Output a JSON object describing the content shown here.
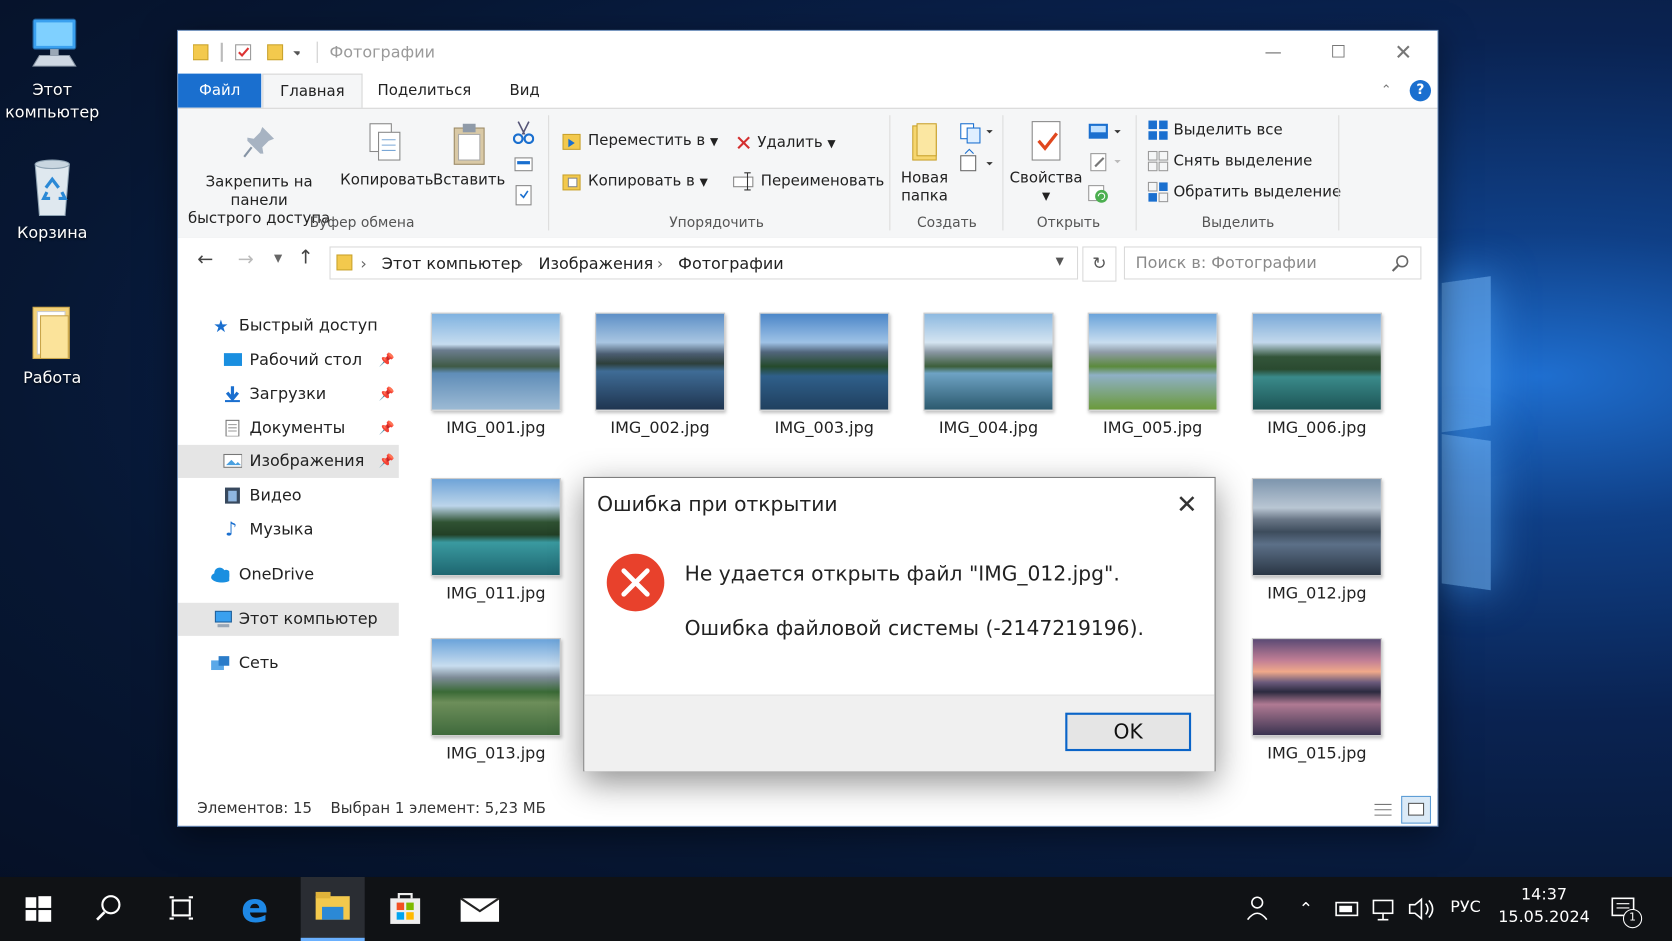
{
  "desktop": {
    "icons": [
      {
        "label_line1": "Этот",
        "label_line2": "компьютер"
      },
      {
        "label_line1": "Корзина",
        "label_line2": ""
      },
      {
        "label_line1": "Работа",
        "label_line2": ""
      }
    ]
  },
  "window": {
    "title": "Фотографии",
    "tabs": [
      "Файл",
      "Главная",
      "Поделиться",
      "Вид"
    ],
    "ribbon": {
      "pin": [
        "Закрепить на панели",
        "быстрого доступа"
      ],
      "copy": "Копировать",
      "paste": "Вставить",
      "group_clipboard": "Буфер обмена",
      "move_to": "Переместить в",
      "copy_to": "Копировать в",
      "delete": "Удалить",
      "rename": "Переименовать",
      "group_organize": "Упорядочить",
      "new_folder": [
        "Новая",
        "папка"
      ],
      "group_create": "Создать",
      "properties": "Свойства",
      "group_open": "Открыть",
      "select_all": "Выделить все",
      "select_none": "Снять выделение",
      "invert_selection": "Обратить выделение",
      "group_select": "Выделить"
    },
    "address": {
      "crumbs": [
        "Этот компьютер",
        "Изображения",
        "Фотографии"
      ],
      "search_placeholder": "Поиск в: Фотографии"
    },
    "nav": {
      "quick_access": "Быстрый доступ",
      "desktop": "Рабочий стол",
      "downloads": "Загрузки",
      "documents": "Документы",
      "pictures": "Изображения",
      "videos": "Видео",
      "music": "Музыка",
      "onedrive": "OneDrive",
      "this_pc": "Этот компьютер",
      "network": "Сеть"
    },
    "files": [
      "IMG_001.jpg",
      "IMG_002.jpg",
      "IMG_003.jpg",
      "IMG_004.jpg",
      "IMG_005.jpg",
      "IMG_006.jpg",
      "IMG_011.jpg",
      "IMG_012.jpg",
      "IMG_013.jpg",
      "IMG_015.jpg"
    ],
    "status": {
      "count": "Элементов: 15",
      "selected": "Выбран 1 элемент: 5,23 МБ"
    }
  },
  "dialog": {
    "title": "Ошибка при открытии",
    "message": "Не удается открыть файл \"IMG_012.jpg\".",
    "detail": "Ошибка файловой системы (-2147219196).",
    "ok": "OK"
  },
  "taskbar": {
    "language": "РУС",
    "time": "14:37",
    "date": "15.05.2024",
    "notification_count": "1"
  }
}
